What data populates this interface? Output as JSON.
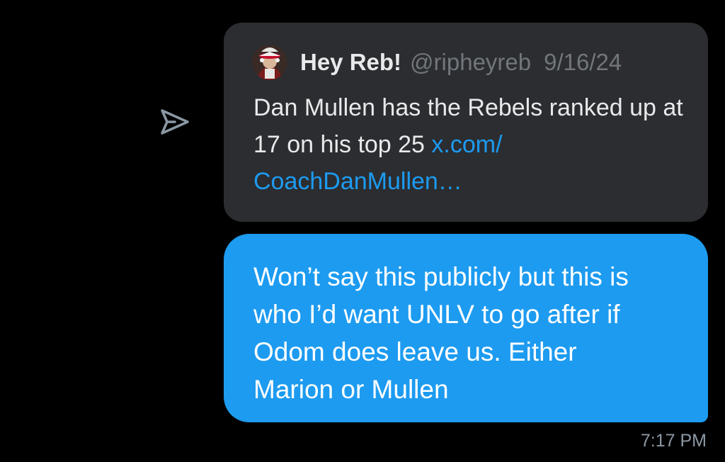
{
  "conversation": {
    "shared_post": {
      "author": {
        "display_name": "Hey Reb!",
        "handle": "@ripheyreb",
        "avatar_icon": "mascot-avatar-icon"
      },
      "date": "9/16/24",
      "text": "Dan Mullen has the Rebels ranked up at 17 on his top 25",
      "link_text": "x.com/​CoachDanMullen…",
      "share_icon": "send-icon"
    },
    "message": {
      "text": "Won’t say this publicly but this is who I’d want UNLV to go after if Odom does leave us. Either Marion or Mullen",
      "timestamp": "7:17 PM"
    }
  },
  "colors": {
    "background": "#000000",
    "card": "#2b2d31",
    "sent_bubble": "#1d9bf0",
    "link": "#1d9bf0",
    "secondary_text": "#71767b"
  }
}
